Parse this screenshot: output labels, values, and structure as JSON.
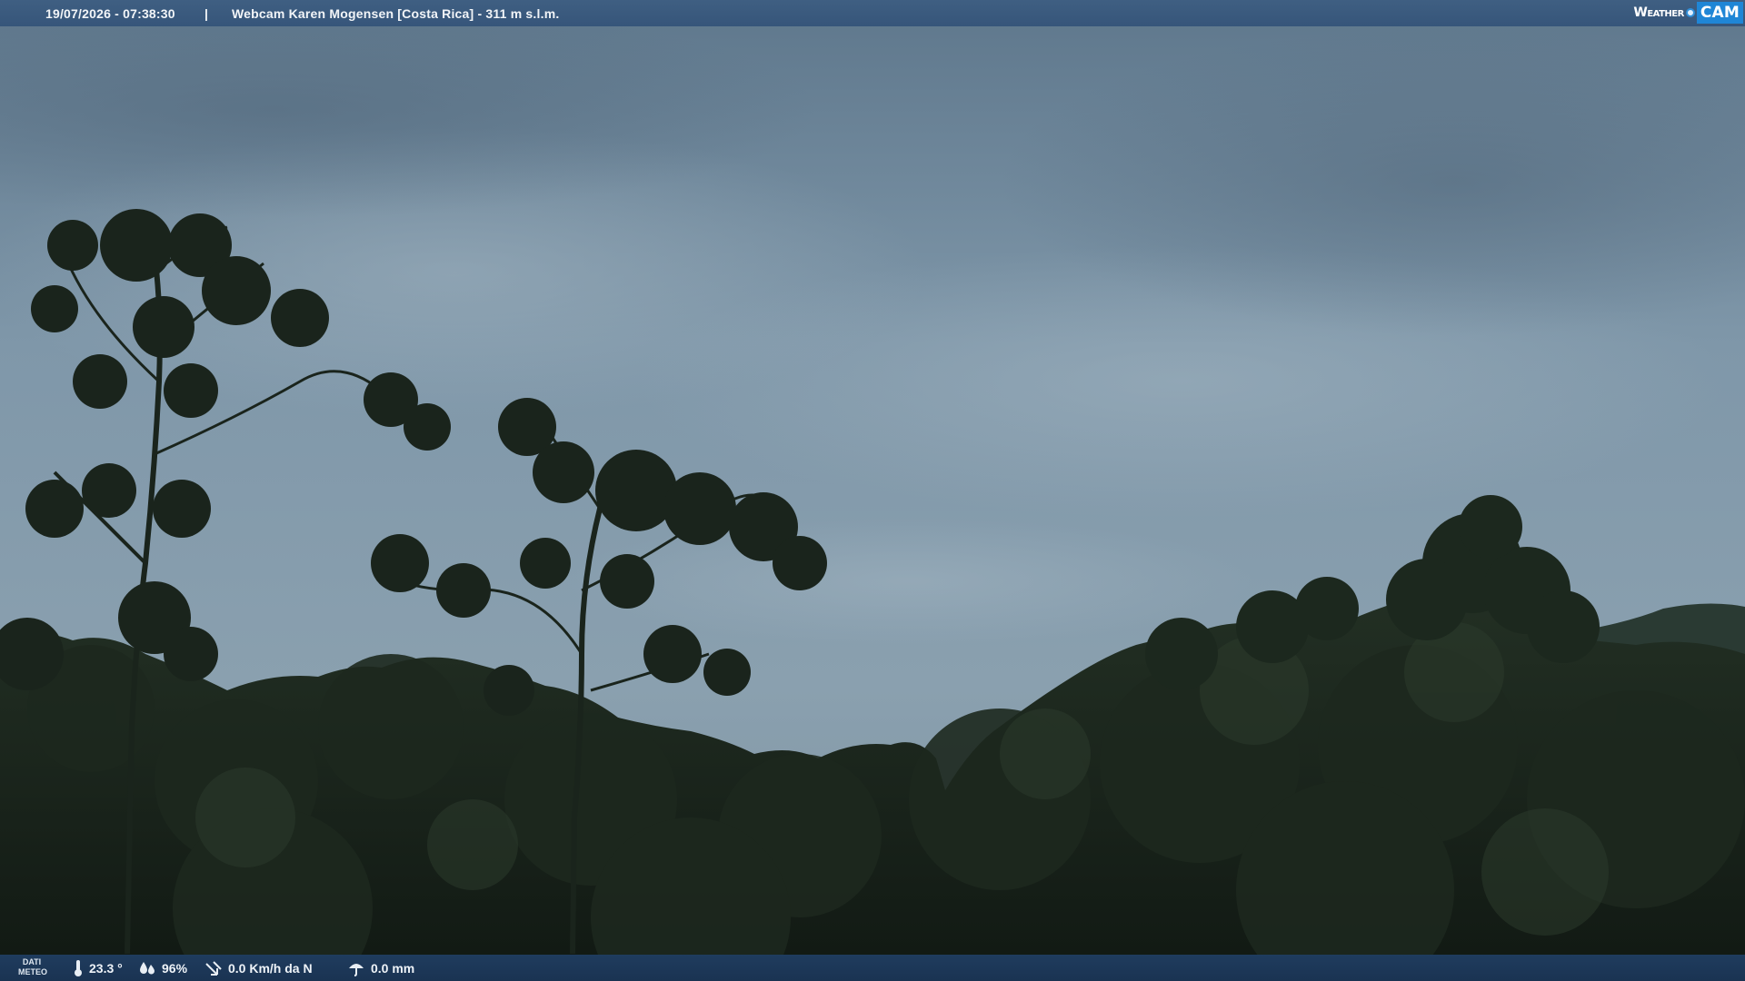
{
  "header": {
    "datetime": "19/07/2026 - 07:38:30",
    "separator": "|",
    "title": "Webcam Karen Mogensen [Costa Rica]  - 311 m s.l.m.",
    "logo": {
      "left": "Weather",
      "right": "CAM",
      "accent": "#1f86d6"
    }
  },
  "footer": {
    "label_line1": "DATI",
    "label_line2": "METEO",
    "temperature": "23.3 °",
    "humidity": "96%",
    "wind": "0.0 Km/h da N",
    "rain": "0.0 mm",
    "icons": [
      "thermometer-icon",
      "humidity-icon",
      "wind-icon",
      "rain-icon"
    ]
  },
  "colors": {
    "bar_top": "#3a5a7e",
    "bar_bottom": "#1c3656",
    "sky": "#7f97a8",
    "forest": "#18221a"
  }
}
